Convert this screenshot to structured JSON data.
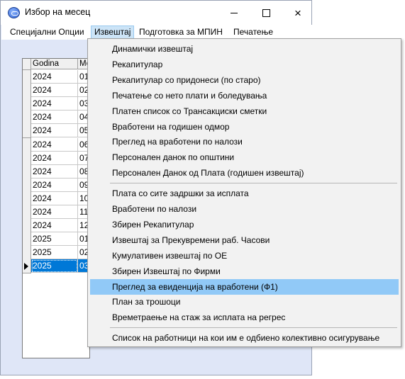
{
  "window": {
    "title": "Избор на месец",
    "icon": "app-icon",
    "controls": {
      "minimize": "minimize-icon",
      "maximize": "maximize-icon",
      "close": "×"
    }
  },
  "menubar": {
    "items": [
      {
        "label": "Специјални Опции"
      },
      {
        "label": "Извештај",
        "active": true
      },
      {
        "label": "Подготовка за МПИН"
      },
      {
        "label": "Печатење"
      }
    ]
  },
  "grid": {
    "headers": [
      "Godina",
      "Ме"
    ],
    "rows": [
      {
        "year": "2024",
        "month": "01"
      },
      {
        "year": "2024",
        "month": "02"
      },
      {
        "year": "2024",
        "month": "03"
      },
      {
        "year": "2024",
        "month": "04"
      },
      {
        "year": "2024",
        "month": "05"
      },
      {
        "year": "2024",
        "month": "06"
      },
      {
        "year": "2024",
        "month": "07"
      },
      {
        "year": "2024",
        "month": "08"
      },
      {
        "year": "2024",
        "month": "09"
      },
      {
        "year": "2024",
        "month": "10"
      },
      {
        "year": "2024",
        "month": "11"
      },
      {
        "year": "2024",
        "month": "12"
      },
      {
        "year": "2025",
        "month": "01"
      },
      {
        "year": "2025",
        "month": "02"
      },
      {
        "year": "2025",
        "month": "03",
        "selected": true
      }
    ]
  },
  "dropdown": {
    "groups": [
      [
        "Динамички извештај",
        "Рекапитулар",
        "Рекапитулар со придонеси (по старо)",
        "Печатење со нето плати и боледувања",
        "Платен список со Трансакциски сметки",
        "Вработени на годишен одмор",
        "Преглед на вработени по налози",
        "Персонален данок по општини",
        "Персонален Данок од Плата (годишен извештај)"
      ],
      [
        "Плата со сите задршки за исплата",
        "Вработени по налози",
        "Збирен Рекапитулар",
        "Извештај за Прекувремени раб. Часови",
        "Кумулативен извештај по ОЕ",
        "Збирен Извештај по Фирми",
        "Преглед за евиденција на вработени (Ф1)",
        "План за трошоци",
        "Времетраење на стаж за исплата на регрес"
      ],
      [
        "Список на работници на кои им е одбиено колективно осигурување"
      ]
    ],
    "highlighted": "Преглед за евиденција на вработени (Ф1)"
  }
}
